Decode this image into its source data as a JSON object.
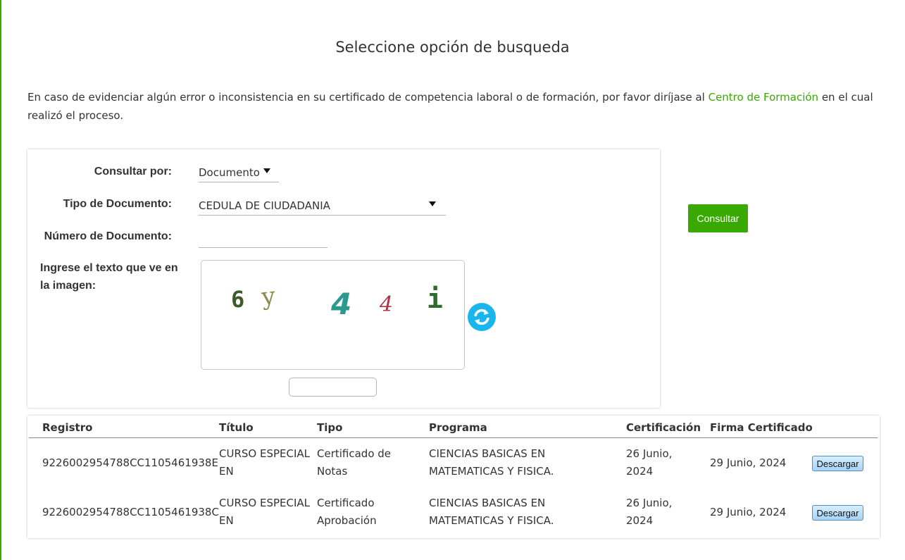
{
  "header": {
    "title": "Seleccione opción de busqueda"
  },
  "notice": {
    "before": "En caso de evidenciar algún error o inconsistencia en su certificado de competencia laboral o de formación, por favor diríjase al ",
    "link": "Centro de Formación",
    "after": " en el cual realizó el proceso."
  },
  "form": {
    "consultar_label": "Consultar por:",
    "consultar_value": "Documento",
    "tipo_label": "Tipo de Documento:",
    "tipo_value": "CEDULA DE CIUDADANIA",
    "numero_label": "Número de Documento:",
    "numero_value": "",
    "captcha_label": "Ingrese el texto que ve en la imagen:",
    "captcha_text": [
      "6",
      "y",
      "4",
      "4",
      "i"
    ],
    "captcha_input_value": ""
  },
  "actions": {
    "consultar_label": "Consultar"
  },
  "colors": {
    "brand_green": "#39a900",
    "refresh_blue": "#19b6ee"
  },
  "results": {
    "headers": [
      "Registro",
      "Título",
      "Tipo",
      "Programa",
      "Certificación",
      "Firma Certificado"
    ],
    "rows": [
      {
        "registro": "9226002954788CC1105461938E",
        "titulo": [
          "CURSO ESPECIAL",
          "EN"
        ],
        "tipo": [
          "Certificado de",
          "Notas"
        ],
        "programa": [
          "CIENCIAS BASICAS EN",
          "MATEMATICAS Y FISICA."
        ],
        "certificacion": [
          "26 Junio,",
          "2024"
        ],
        "firma": "29 Junio, 2024",
        "action": "Descargar"
      },
      {
        "registro": "9226002954788CC1105461938C",
        "titulo": [
          "CURSO ESPECIAL",
          "EN"
        ],
        "tipo": [
          "Certificado",
          "Aprobación"
        ],
        "programa": [
          "CIENCIAS BASICAS EN",
          "MATEMATICAS Y FISICA."
        ],
        "certificacion": [
          "26 Junio,",
          "2024"
        ],
        "firma": "29 Junio, 2024",
        "action": "Descargar"
      }
    ]
  }
}
